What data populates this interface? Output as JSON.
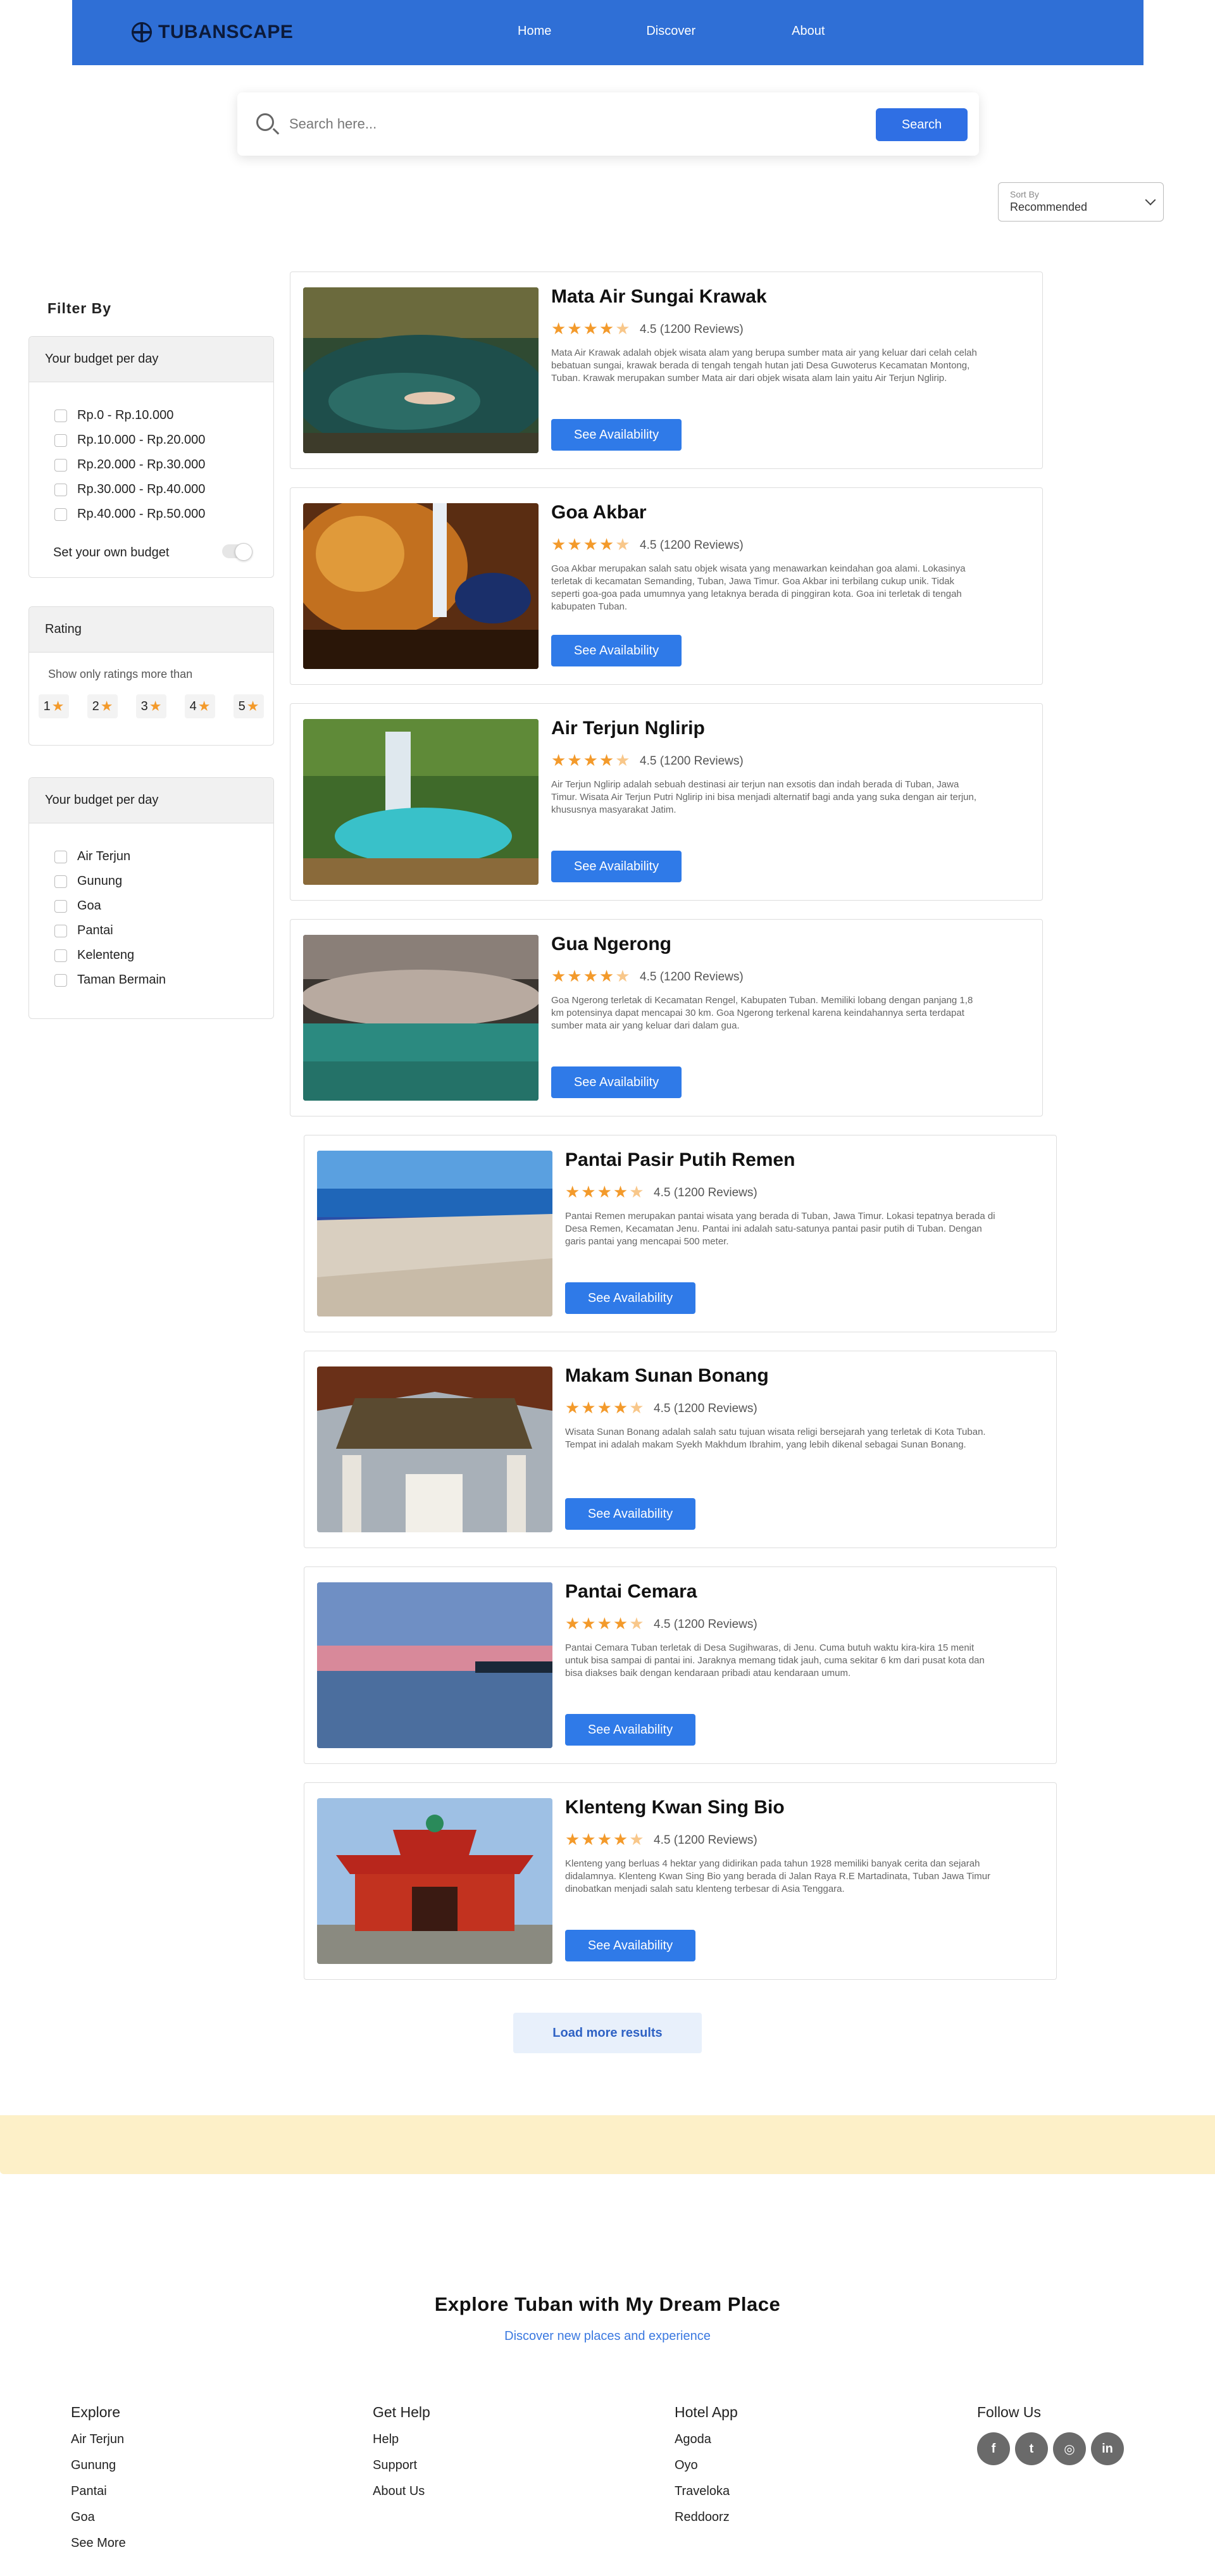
{
  "header": {
    "logo_text": "TUBANSCAPE",
    "nav": [
      "Home",
      "Discover",
      "About"
    ]
  },
  "search": {
    "placeholder": "Search here...",
    "button_label": "Search"
  },
  "sort": {
    "label": "Sort By",
    "value": "Recommended"
  },
  "sidebar": {
    "title": "Filter By",
    "budget_panel": {
      "title": "Your budget per day",
      "options": [
        "Rp.0 - Rp.10.000",
        "Rp.10.000 - Rp.20.000",
        "Rp.20.000 - Rp.30.000",
        "Rp.30.000 - Rp.40.000",
        "Rp.40.000 - Rp.50.000"
      ],
      "own_budget_label": "Set your own budget"
    },
    "rating_panel": {
      "title": "Rating",
      "caption": "Show only ratings more than",
      "values": [
        "1",
        "2",
        "3",
        "4",
        "5"
      ]
    },
    "category_panel": {
      "title": "Your budget per day",
      "options": [
        "Air Terjun",
        "Gunung",
        "Goa",
        "Pantai",
        "Kelenteng",
        "Taman Bermain"
      ]
    }
  },
  "results": [
    {
      "title": "Mata Air Sungai Krawak",
      "rating": "4.5",
      "reviews": "4.5 (1200 Reviews)",
      "description": "Mata Air Krawak adalah objek wisata alam yang berupa sumber mata air yang keluar dari celah celah bebatuan sungai, krawak berada di tengah tengah hutan jati Desa Guwoterus Kecamatan Montong, Tuban. Krawak merupakan sumber Mata air dari objek wisata alam lain yaitu Air Terjun Nglirip.",
      "button": "See Availability"
    },
    {
      "title": "Goa Akbar",
      "rating": "4.5",
      "reviews": "4.5 (1200 Reviews)",
      "description": "Goa Akbar merupakan salah satu objek wisata yang menawarkan keindahan goa alami. Lokasinya terletak di kecamatan Semanding, Tuban, Jawa Timur. Goa Akbar ini terbilang cukup unik. Tidak seperti goa-goa pada umumnya yang letaknya berada di pinggiran kota. Goa ini terletak di tengah kabupaten Tuban.",
      "button": "See Availability"
    },
    {
      "title": "Air Terjun Nglirip",
      "rating": "4.5",
      "reviews": "4.5 (1200 Reviews)",
      "description": "Air Terjun Nglirip adalah sebuah destinasi air terjun nan exsotis dan indah berada di Tuban, Jawa Timur. Wisata Air Terjun Putri Nglirip ini bisa menjadi alternatif bagi anda yang suka dengan air terjun, khususnya masyarakat Jatim.",
      "button": "See Availability"
    },
    {
      "title": "Gua Ngerong",
      "rating": "4.5",
      "reviews": "4.5 (1200 Reviews)",
      "description": "Goa Ngerong terletak di Kecamatan Rengel, Kabupaten Tuban. Memiliki lobang dengan panjang 1,8 km potensinya dapat mencapai 30 km. Goa Ngerong terkenal karena keindahannya serta terdapat sumber mata air yang keluar dari dalam gua.",
      "button": "See Availability"
    },
    {
      "title": "Pantai Pasir Putih Remen",
      "rating": "4.5",
      "reviews": "4.5 (1200 Reviews)",
      "description": "Pantai Remen merupakan pantai wisata yang berada di Tuban, Jawa Timur. Lokasi tepatnya berada di Desa Remen, Kecamatan Jenu. Pantai ini adalah satu-satunya pantai pasir putih di Tuban. Dengan garis pantai yang mencapai 500 meter.",
      "button": "See Availability"
    },
    {
      "title": "Makam Sunan Bonang",
      "rating": "4.5",
      "reviews": "4.5 (1200 Reviews)",
      "description": "Wisata Sunan Bonang adalah salah satu tujuan wisata religi bersejarah yang terletak di Kota Tuban. Tempat ini adalah makam Syekh Makhdum Ibrahim, yang lebih dikenal sebagai Sunan Bonang.",
      "button": "See Availability"
    },
    {
      "title": "Pantai Cemara",
      "rating": "4.5",
      "reviews": "4.5 (1200 Reviews)",
      "description": "Pantai Cemara Tuban terletak di Desa Sugihwaras, di Jenu. Cuma butuh waktu kira-kira 15 menit untuk bisa sampai di pantai ini. Jaraknya memang tidak jauh, cuma sekitar 6 km dari pusat kota dan bisa diakses baik dengan kendaraan pribadi atau kendaraan umum.",
      "button": "See Availability"
    },
    {
      "title": "Klenteng Kwan Sing Bio",
      "rating": "4.5",
      "reviews": "4.5 (1200 Reviews)",
      "description": "Klenteng yang berluas 4 hektar yang didirikan pada tahun 1928 memiliki banyak cerita dan sejarah didalamnya. Klenteng Kwan Sing Bio yang berada di Jalan Raya R.E Martadinata, Tuban Jawa Timur dinobatkan menjadi salah satu klenteng terbesar di Asia Tenggara.",
      "button": "See Availability"
    }
  ],
  "load_more": "Load more results",
  "explore": {
    "title": "Explore Tuban with My Dream Place",
    "subtitle": "Discover new places and experience"
  },
  "footer": {
    "explore": {
      "title": "Explore",
      "links": [
        "Air Terjun",
        "Gunung",
        "Pantai",
        "Goa",
        "See More"
      ]
    },
    "get_help": {
      "title": "Get Help",
      "links": [
        "Help",
        "Support",
        "About Us"
      ]
    },
    "hotel_app": {
      "title": "Hotel App",
      "links": [
        "Agoda",
        "Oyo",
        "Traveloka",
        "Reddoorz"
      ]
    },
    "follow_us": {
      "title": "Follow Us",
      "icons": [
        "facebook-icon",
        "twitter-icon",
        "instagram-icon",
        "linkedin-icon"
      ]
    }
  },
  "colors": {
    "header_bg": "#2f6fd6",
    "primary_button": "#2f7ae8",
    "star": "#f39a2b",
    "band": "#fdf0c8"
  }
}
